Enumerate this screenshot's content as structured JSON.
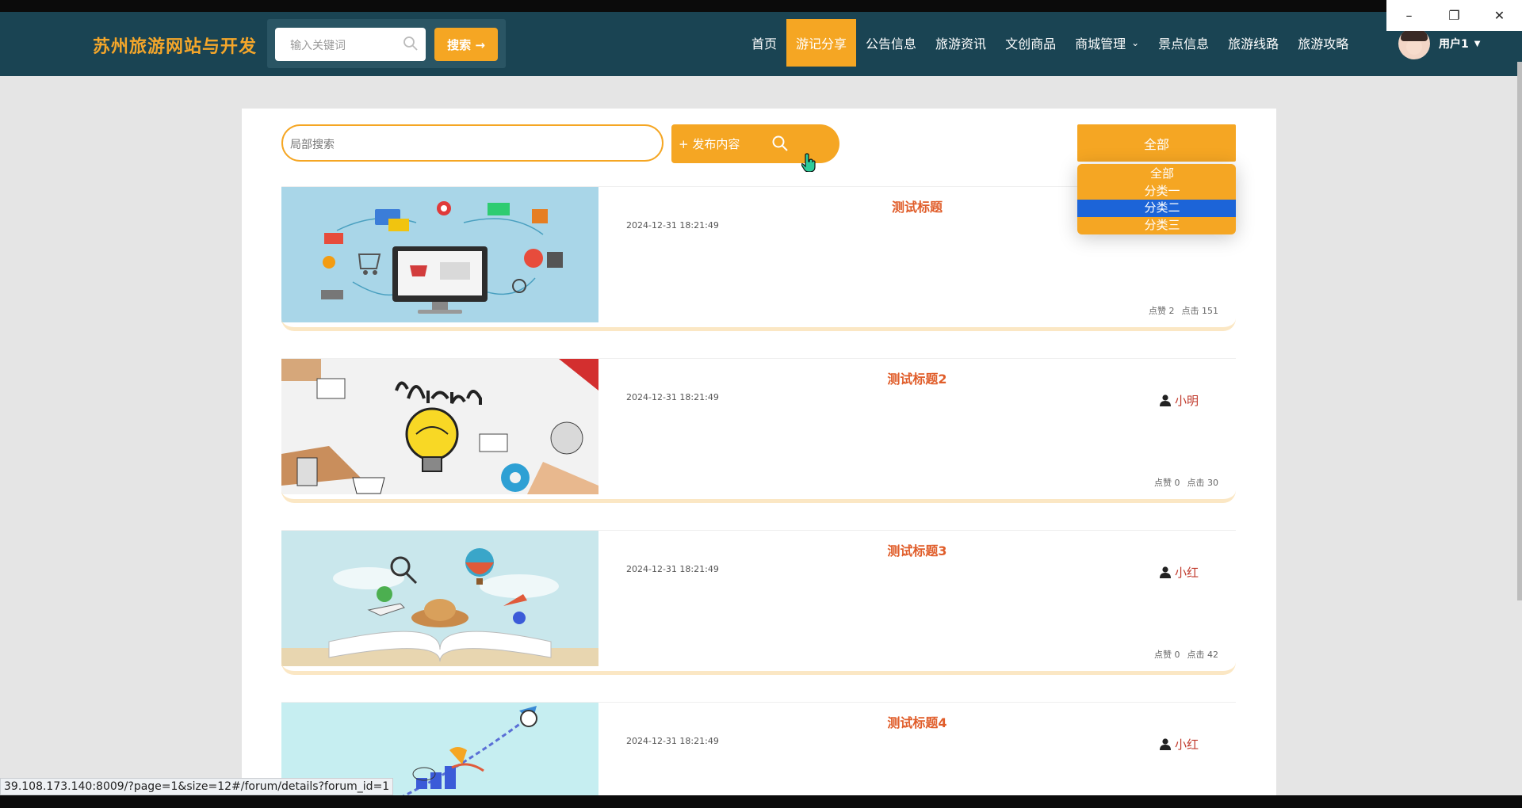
{
  "window": {
    "min_icon": "minimize-icon",
    "max_icon": "restore-icon",
    "close_icon": "close-icon"
  },
  "header": {
    "brand": "苏州旅游网站与开发",
    "search_placeholder": "输入关键词",
    "search_button": "搜索 →",
    "nav": [
      {
        "label": "首页",
        "active": false
      },
      {
        "label": "游记分享",
        "active": true
      },
      {
        "label": "公告信息",
        "active": false
      },
      {
        "label": "旅游资讯",
        "active": false
      },
      {
        "label": "文创商品",
        "active": false
      },
      {
        "label": "商城管理",
        "active": false,
        "dropdown": true
      },
      {
        "label": "景点信息",
        "active": false
      },
      {
        "label": "旅游线路",
        "active": false
      },
      {
        "label": "旅游攻略",
        "active": false
      }
    ],
    "user_name": "用户1"
  },
  "toolbar": {
    "local_search_placeholder": "局部搜索",
    "publish_label": "+ 发布内容",
    "category_selected": "全部",
    "category_options": [
      "全部",
      "分类一",
      "分类二",
      "分类三"
    ],
    "category_highlighted": "分类二"
  },
  "posts": [
    {
      "title": "测试标题",
      "date": "2024-12-31 18:21:49",
      "author": "",
      "likes": "点赞 2",
      "clicks": "点击 151",
      "image": "online-shopping-illustration"
    },
    {
      "title": "测试标题2",
      "date": "2024-12-31 18:21:49",
      "author": "小明",
      "likes": "点赞 0",
      "clicks": "点击 30",
      "image": "learn-lightbulb-illustration"
    },
    {
      "title": "测试标题3",
      "date": "2024-12-31 18:21:49",
      "author": "小红",
      "likes": "点赞 0",
      "clicks": "点击 42",
      "image": "travel-book-illustration"
    },
    {
      "title": "测试标题4",
      "date": "2024-12-31 18:21:49",
      "author": "小红",
      "likes": "",
      "clicks": "",
      "image": "rocket-win-illustration"
    }
  ],
  "status_url": "39.108.173.140:8009/?page=1&size=12#/forum/details?forum_id=1",
  "colors": {
    "header_bg": "#1a4453",
    "accent": "#f5a623",
    "title": "#e05d2a",
    "author": "#c0392b",
    "select_highlight": "#1c64d8"
  }
}
